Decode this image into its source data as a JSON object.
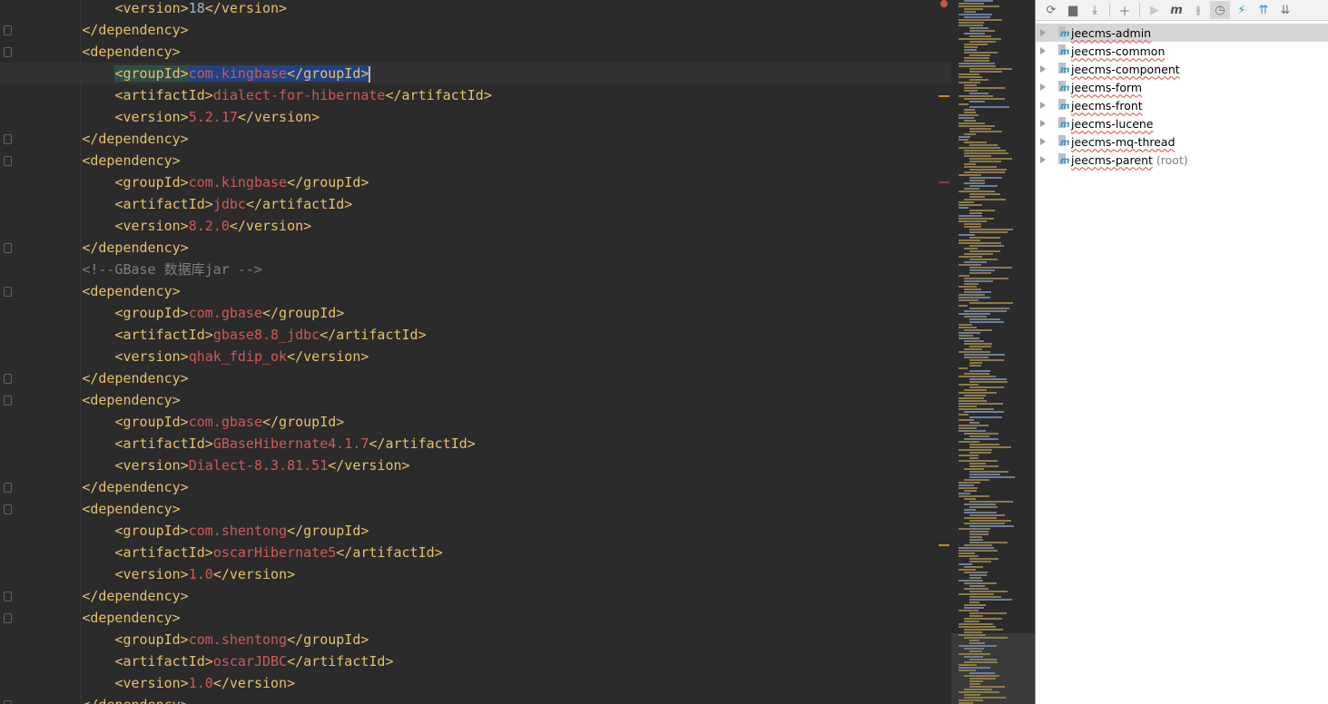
{
  "editor": {
    "lines": [
      {
        "indent": 3,
        "parts": [
          [
            "tag",
            "<version>"
          ],
          [
            "num",
            "18"
          ],
          [
            "tag",
            "</version>"
          ]
        ]
      },
      {
        "indent": 2,
        "parts": [
          [
            "tag",
            "</dependency>"
          ]
        ],
        "fold": true
      },
      {
        "indent": 2,
        "parts": [
          [
            "tag",
            "<dependency>"
          ]
        ],
        "fold": true
      },
      {
        "indent": 3,
        "current": true,
        "parts": [
          [
            "sel-tag tag",
            "<groupId>"
          ],
          [
            "sel val",
            "com.kingbase"
          ],
          [
            "sel tag",
            "</groupId>"
          ]
        ]
      },
      {
        "indent": 3,
        "parts": [
          [
            "tag",
            "<artifactId>"
          ],
          [
            "val",
            "dialect-for-hibernate"
          ],
          [
            "tag",
            "</artifactId>"
          ]
        ]
      },
      {
        "indent": 3,
        "parts": [
          [
            "tag",
            "<version>"
          ],
          [
            "val",
            "5.2.17"
          ],
          [
            "tag",
            "</version>"
          ]
        ]
      },
      {
        "indent": 2,
        "parts": [
          [
            "tag",
            "</dependency>"
          ]
        ],
        "fold": true
      },
      {
        "indent": 2,
        "parts": [
          [
            "tag",
            "<dependency>"
          ]
        ],
        "fold": true
      },
      {
        "indent": 3,
        "parts": [
          [
            "tag",
            "<groupId>"
          ],
          [
            "val",
            "com.kingbase"
          ],
          [
            "tag",
            "</groupId>"
          ]
        ]
      },
      {
        "indent": 3,
        "parts": [
          [
            "tag",
            "<artifactId>"
          ],
          [
            "val",
            "jdbc"
          ],
          [
            "tag",
            "</artifactId>"
          ]
        ]
      },
      {
        "indent": 3,
        "parts": [
          [
            "tag",
            "<version>"
          ],
          [
            "val",
            "8.2.0"
          ],
          [
            "tag",
            "</version>"
          ]
        ]
      },
      {
        "indent": 2,
        "parts": [
          [
            "tag",
            "</dependency>"
          ]
        ],
        "fold": true
      },
      {
        "indent": 2,
        "parts": [
          [
            "cmt",
            "<!--GBase 数据库jar -->"
          ]
        ]
      },
      {
        "indent": 2,
        "parts": [
          [
            "tag",
            "<dependency>"
          ]
        ],
        "fold": true
      },
      {
        "indent": 3,
        "parts": [
          [
            "tag",
            "<groupId>"
          ],
          [
            "val",
            "com.gbase"
          ],
          [
            "tag",
            "</groupId>"
          ]
        ]
      },
      {
        "indent": 3,
        "parts": [
          [
            "tag",
            "<artifactId>"
          ],
          [
            "val",
            "gbase8.8_jdbc"
          ],
          [
            "tag",
            "</artifactId>"
          ]
        ]
      },
      {
        "indent": 3,
        "parts": [
          [
            "tag",
            "<version>"
          ],
          [
            "val",
            "qhak_fdip_ok"
          ],
          [
            "tag",
            "</version>"
          ]
        ]
      },
      {
        "indent": 2,
        "parts": [
          [
            "tag",
            "</dependency>"
          ]
        ],
        "fold": true
      },
      {
        "indent": 2,
        "parts": [
          [
            "tag",
            "<dependency>"
          ]
        ],
        "fold": true
      },
      {
        "indent": 3,
        "parts": [
          [
            "tag",
            "<groupId>"
          ],
          [
            "val",
            "com.gbase"
          ],
          [
            "tag",
            "</groupId>"
          ]
        ]
      },
      {
        "indent": 3,
        "parts": [
          [
            "tag",
            "<artifactId>"
          ],
          [
            "val",
            "GBaseHibernate4.1.7"
          ],
          [
            "tag",
            "</artifactId>"
          ]
        ]
      },
      {
        "indent": 3,
        "parts": [
          [
            "tag",
            "<version>"
          ],
          [
            "val",
            "Dialect-8.3.81.51"
          ],
          [
            "tag",
            "</version>"
          ]
        ]
      },
      {
        "indent": 2,
        "parts": [
          [
            "tag",
            "</dependency>"
          ]
        ],
        "fold": true
      },
      {
        "indent": 2,
        "parts": [
          [
            "tag",
            "<dependency>"
          ]
        ],
        "fold": true
      },
      {
        "indent": 3,
        "parts": [
          [
            "tag",
            "<groupId>"
          ],
          [
            "val",
            "com.shentong"
          ],
          [
            "tag",
            "</groupId>"
          ]
        ]
      },
      {
        "indent": 3,
        "parts": [
          [
            "tag",
            "<artifactId>"
          ],
          [
            "val",
            "oscarHibernate5"
          ],
          [
            "tag",
            "</artifactId>"
          ]
        ]
      },
      {
        "indent": 3,
        "parts": [
          [
            "tag",
            "<version>"
          ],
          [
            "val",
            "1.0"
          ],
          [
            "tag",
            "</version>"
          ]
        ]
      },
      {
        "indent": 2,
        "parts": [
          [
            "tag",
            "</dependency>"
          ]
        ],
        "fold": true
      },
      {
        "indent": 2,
        "parts": [
          [
            "tag",
            "<dependency>"
          ]
        ],
        "fold": true
      },
      {
        "indent": 3,
        "parts": [
          [
            "tag",
            "<groupId>"
          ],
          [
            "val",
            "com.shentong"
          ],
          [
            "tag",
            "</groupId>"
          ]
        ]
      },
      {
        "indent": 3,
        "parts": [
          [
            "tag",
            "<artifactId>"
          ],
          [
            "val",
            "oscarJDBC"
          ],
          [
            "tag",
            "</artifactId>"
          ]
        ]
      },
      {
        "indent": 3,
        "parts": [
          [
            "tag",
            "<version>"
          ],
          [
            "val",
            "1.0"
          ],
          [
            "tag",
            "</version>"
          ]
        ]
      },
      {
        "indent": 2,
        "parts": [
          [
            "tag",
            "</dependency>"
          ]
        ],
        "fold": true
      }
    ]
  },
  "maven_panel": {
    "toolbar": [
      "refresh-icon",
      "add-folder-icon",
      "download-icon",
      "plus-icon",
      "run-icon",
      "maven-goal-icon",
      "toggle-offline-icon",
      "skip-tests-icon",
      "lightning-icon",
      "expand-all-icon",
      "collapse-all-icon"
    ],
    "projects": [
      {
        "name": "jeecms-admin",
        "selected": true
      },
      {
        "name": "jeecms-common"
      },
      {
        "name": "jeecms-component"
      },
      {
        "name": "jeecms-form"
      },
      {
        "name": "jeecms-front"
      },
      {
        "name": "jeecms-lucene"
      },
      {
        "name": "jeecms-mq-thread"
      },
      {
        "name": "jeecms-parent",
        "suffix": "(root)"
      }
    ]
  },
  "colors": {
    "tag": "#e8bf6a",
    "value": "#cc5a5a",
    "background": "#2b2b2b",
    "error": "#c75450",
    "warning": "#be9117"
  }
}
